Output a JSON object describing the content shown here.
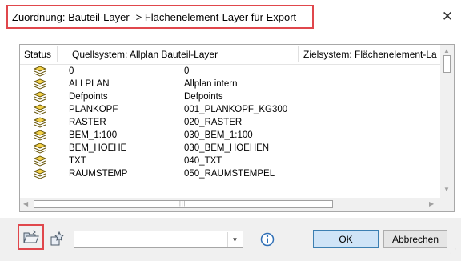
{
  "window": {
    "title": "Zuordnung: Bauteil-Layer -> Flächenelement-Layer für Export",
    "close_glyph": "✕"
  },
  "table": {
    "columns": [
      "Status",
      "Quellsystem: Allplan Bauteil-Layer",
      "Zielsystem: Flächenelement-La"
    ],
    "rows": [
      {
        "status_icon": "layer-status-icon",
        "source": "0",
        "target": "0"
      },
      {
        "status_icon": "layer-status-icon",
        "source": "ALLPLAN",
        "target": "Allplan intern"
      },
      {
        "status_icon": "layer-status-icon",
        "source": "Defpoints",
        "target": "Defpoints"
      },
      {
        "status_icon": "layer-status-icon",
        "source": "PLANKOPF",
        "target": "001_PLANKOPF_KG300"
      },
      {
        "status_icon": "layer-status-icon",
        "source": "RASTER",
        "target": "020_RASTER"
      },
      {
        "status_icon": "layer-status-icon",
        "source": "BEM_1:100",
        "target": "030_BEM_1:100"
      },
      {
        "status_icon": "layer-status-icon",
        "source": "BEM_HOEHE",
        "target": "030_BEM_HOEHEN"
      },
      {
        "status_icon": "layer-status-icon",
        "source": "TXT",
        "target": "040_TXT"
      },
      {
        "status_icon": "layer-status-icon",
        "source": "RAUMSTEMP",
        "target": "050_RAUMSTEMPEL"
      }
    ]
  },
  "toolbar": {
    "open_icon": "folder-open-icon",
    "favorite_icon": "favorite-pin-icon",
    "combo_value": "",
    "info_icon": "info-icon"
  },
  "buttons": {
    "ok_label": "OK",
    "cancel_label": "Abbrechen"
  },
  "colors": {
    "highlight_border": "#e0474c",
    "ok_button_bg": "#cfe4f7",
    "dialog_footer_bg": "#f0f0f0"
  }
}
